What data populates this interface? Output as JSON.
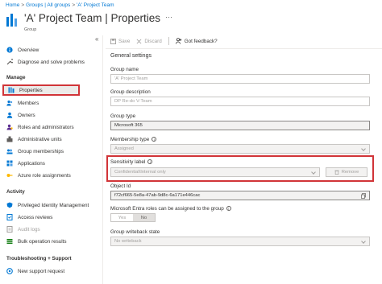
{
  "breadcrumb": {
    "items": [
      "Home",
      "Groups | All groups",
      "'A' Project Team"
    ],
    "sep": ">"
  },
  "header": {
    "title": "'A' Project Team | Properties",
    "more": "···",
    "subtitle": "Group"
  },
  "sidebar": {
    "collapse": "«",
    "top_items": [
      "Overview",
      "Diagnose and solve problems"
    ],
    "manage_title": "Manage",
    "manage_items": [
      "Properties",
      "Members",
      "Owners",
      "Roles and administrators",
      "Administrative units",
      "Group memberships",
      "Applications",
      "Azure role assignments"
    ],
    "activity_title": "Activity",
    "activity_items": [
      "Privileged Identity Management",
      "Access reviews",
      "Audit logs",
      "Bulk operation results"
    ],
    "troubleshooting_title": "Troubleshooting + Support",
    "troubleshooting_items": [
      "New support request"
    ]
  },
  "toolbar": {
    "save": "Save",
    "discard": "Discard",
    "feedback": "Got feedback?"
  },
  "form": {
    "section": "General settings",
    "group_name_label": "Group name",
    "group_name_value": "'A' Project Team",
    "group_description_label": "Group description",
    "group_description_value": "DP Re-do V-Team",
    "group_type_label": "Group type",
    "group_type_value": "Microsoft 365",
    "membership_type_label": "Membership type",
    "membership_type_value": "Assigned",
    "sensitivity_label": "Sensitivity label",
    "sensitivity_value": "Confidential\\Internal only",
    "remove": "Remove",
    "object_id_label": "Object Id",
    "object_id_value": "f72cf665-5e8a-47ab-9d8c-6a171e446cac",
    "entra_roles_label": "Microsoft Entra roles can be assigned to the group",
    "toggle_yes": "Yes",
    "toggle_no": "No",
    "writeback_label": "Group writeback state",
    "writeback_value": "No writeback"
  },
  "colors": {
    "accent": "#0078d4",
    "highlight_border": "#d13438"
  }
}
